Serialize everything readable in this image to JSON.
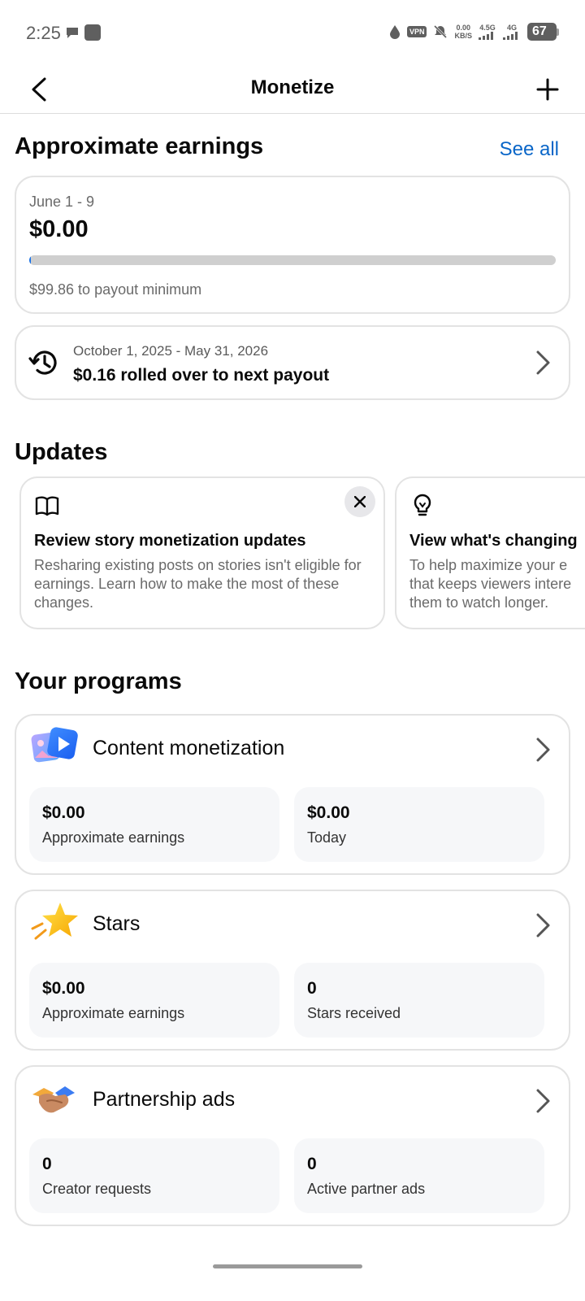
{
  "status_bar": {
    "time": "2:25",
    "vpn": "VPN",
    "speed_value": "0.00",
    "speed_unit": "KB/S",
    "net1": "4.5G",
    "net2": "4G",
    "battery": "67"
  },
  "header": {
    "title": "Monetize"
  },
  "earnings": {
    "heading": "Approximate earnings",
    "see_all": "See all",
    "range": "June 1 - 9",
    "amount": "$0.00",
    "progress_fraction": 0.002,
    "payout_text": "$99.86 to payout minimum",
    "rollover_range": "October 1, 2025 - May 31, 2026",
    "rollover_text": "$0.16 rolled over to next payout"
  },
  "updates": {
    "heading": "Updates",
    "cards": [
      {
        "icon": "book-icon",
        "title": "Review story monetization updates",
        "body": "Resharing existing posts on stories isn't eligible for earnings. Learn how to make the most of these changes."
      },
      {
        "icon": "lightbulb-icon",
        "title": "View what's changing",
        "body": "To help maximize your e that keeps viewers intere them to watch longer."
      }
    ]
  },
  "programs": {
    "heading": "Your programs",
    "items": [
      {
        "title": "Content monetization",
        "icon": "content-monetization-icon",
        "stats": [
          {
            "value": "$0.00",
            "label": "Approximate earnings"
          },
          {
            "value": "$0.00",
            "label": "Today"
          }
        ]
      },
      {
        "title": "Stars",
        "icon": "star-icon",
        "stats": [
          {
            "value": "$0.00",
            "label": "Approximate earnings"
          },
          {
            "value": "0",
            "label": "Stars received"
          }
        ]
      },
      {
        "title": "Partnership ads",
        "icon": "handshake-icon",
        "stats": [
          {
            "value": "0",
            "label": "Creator requests"
          },
          {
            "value": "0",
            "label": "Active partner ads"
          }
        ]
      }
    ]
  },
  "colors": {
    "link": "#0a66c8",
    "progress_fill": "#1a73e8",
    "progress_track": "#cfcfcf"
  }
}
